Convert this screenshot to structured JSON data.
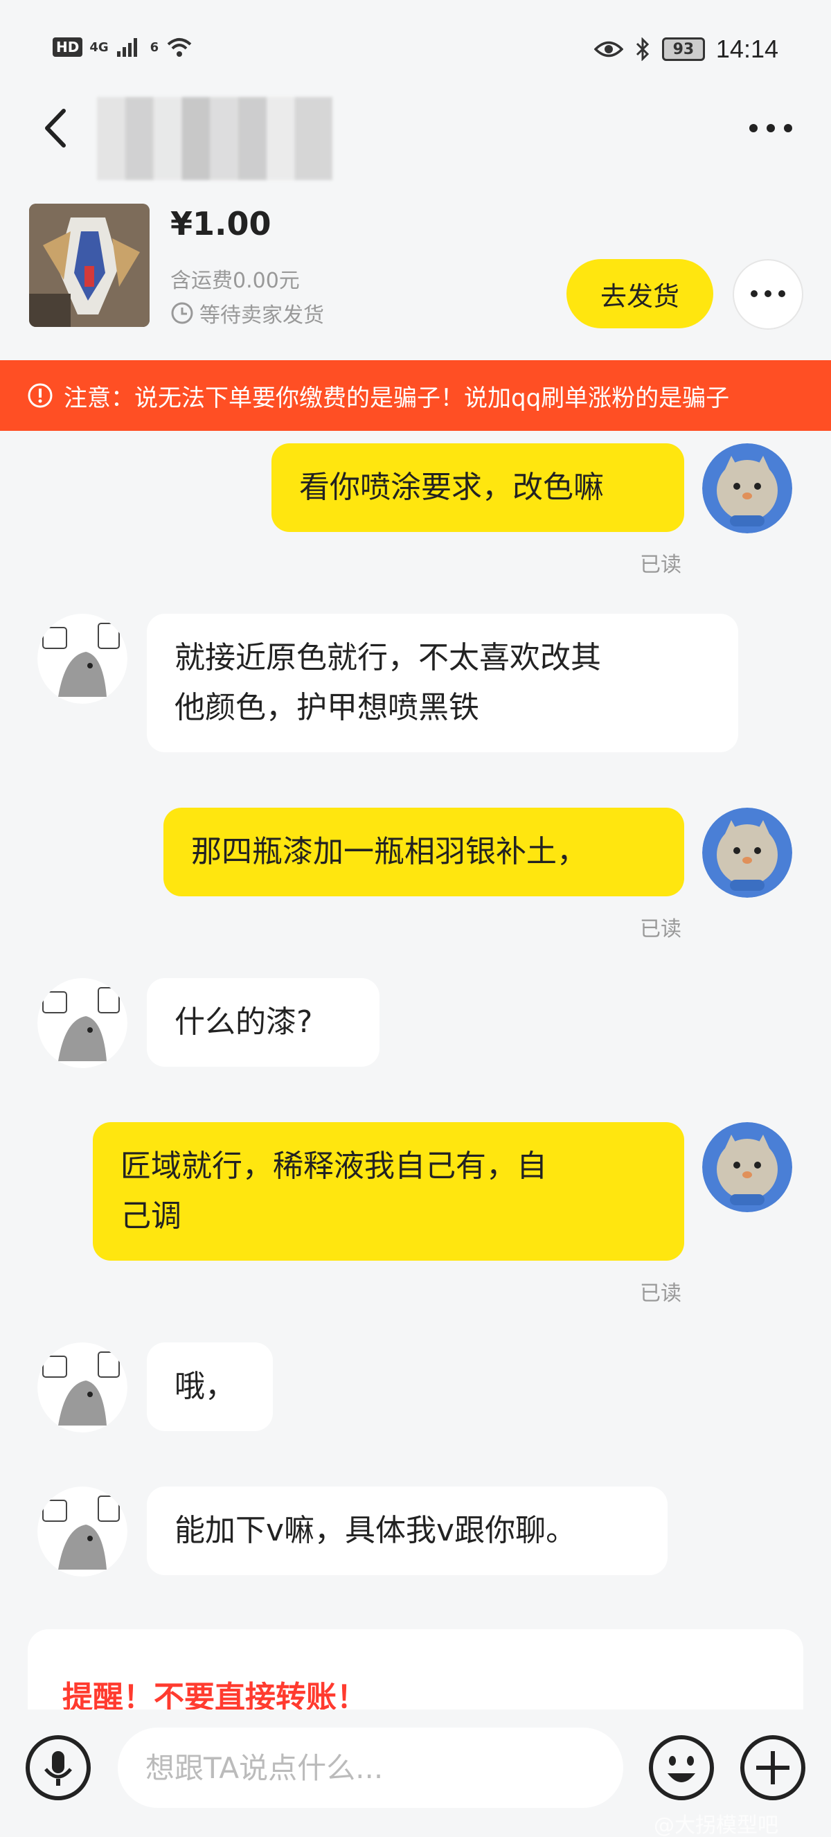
{
  "status_bar": {
    "hd": "HD",
    "network": "4G",
    "network2": "6",
    "battery": "93",
    "time": "14:14"
  },
  "product": {
    "price": "¥1.00",
    "shipping": "含运费0.00元",
    "status": "等待卖家发货",
    "ship_button": "去发货"
  },
  "warning": {
    "text": "注意：说无法下单要你缴费的是骗子！说加qq刷单涨粉的是骗子"
  },
  "messages": [
    {
      "text": "看你喷涂要求，改色嘛",
      "read": "已读"
    },
    {
      "text_line1": "就接近原色就行，不太喜欢改其",
      "text_line2": "他颜色，护甲想喷黑铁"
    },
    {
      "text": "那四瓶漆加一瓶相羽银补土，",
      "read": "已读"
    },
    {
      "text": "什么的漆?"
    },
    {
      "text_line1": "匠域就行，稀释液我自己有，自",
      "text_line2": "己调",
      "read": "已读"
    },
    {
      "text": "哦，"
    },
    {
      "text": "能加下v嘛，具体我v跟你聊。"
    }
  ],
  "reminder": {
    "text": "提醒！不要直接转账！"
  },
  "input": {
    "placeholder": "想跟TA说点什么..."
  },
  "watermark": "@大拐模型吧",
  "colors": {
    "accent_yellow": "#ffe60f",
    "warning_orange": "#ff4f24",
    "reminder_red": "#ff3b2f",
    "background": "#f5f6f7"
  },
  "icons": {
    "back": "chevron-left-icon",
    "more": "more-dots-icon",
    "clock": "clock-icon",
    "alert": "alert-circle-icon",
    "mic": "microphone-icon",
    "emoji": "emoji-icon",
    "add": "plus-icon"
  }
}
